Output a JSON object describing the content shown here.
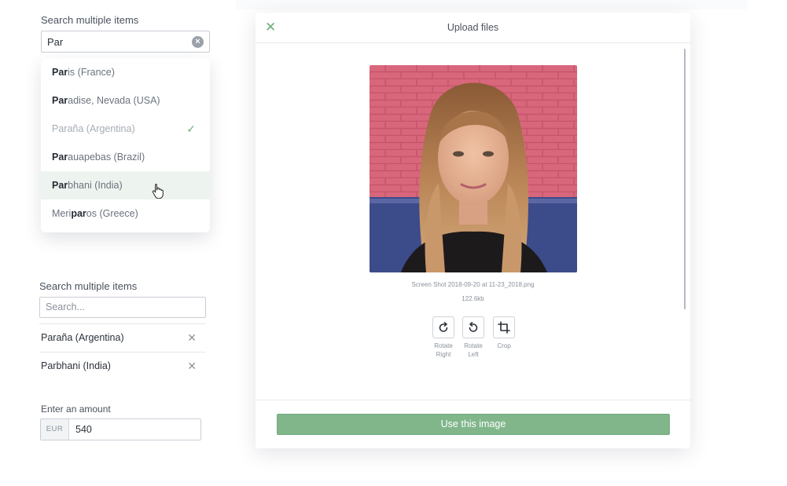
{
  "search_one": {
    "label": "Search multiple items",
    "value": "Par",
    "clear_icon": "clear-circle-icon",
    "options": [
      {
        "match": "Par",
        "rest": "is (France)"
      },
      {
        "match": "Par",
        "rest": "adise, Nevada (USA)"
      },
      {
        "text": "Paraña (Argentina)",
        "selected": true
      },
      {
        "match": "Par",
        "rest": "auapebas (Brazil)"
      },
      {
        "match": "Par",
        "rest": "bhani (India)",
        "hovered": true
      },
      {
        "prefix": "Meri",
        "match": "par",
        "rest": "os (Greece)"
      }
    ],
    "check_icon": "checkmark-icon"
  },
  "search_two": {
    "label": "Search multiple items",
    "placeholder": "Search...",
    "selected": [
      {
        "label": "Paraña (Argentina)"
      },
      {
        "label": "Parbhani (India)"
      }
    ]
  },
  "amount": {
    "label": "Enter an amount",
    "currency": "EUR",
    "value": "540"
  },
  "modal": {
    "title": "Upload files",
    "file_name": "Screen Shot 2018-09-20 at 11-23_2018.png",
    "file_size": "122.6kb",
    "tools": [
      {
        "label_line1": "Rotate",
        "label_line2": "Right",
        "icon": "rotate-right-icon"
      },
      {
        "label_line1": "Rotate",
        "label_line2": "Left",
        "icon": "rotate-left-icon"
      },
      {
        "label_line1": "Crop",
        "label_line2": "",
        "icon": "crop-icon"
      }
    ],
    "primary_button": "Use this image"
  },
  "colors": {
    "accent_green": "#80b68a",
    "hover_row": "#edf4ef",
    "check_green": "#6dae7e"
  }
}
